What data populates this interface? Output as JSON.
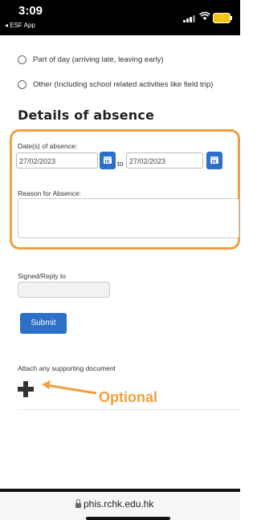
{
  "status_bar": {
    "time": "3:09",
    "back_app": "◂ ESF App"
  },
  "form": {
    "options": [
      {
        "label": "Part of day (arriving late, leaving early)"
      },
      {
        "label": "Other (Including school related activities like field trip)"
      }
    ],
    "section_title": "Details of absence",
    "date_label": "Date(s) of absence:",
    "date_from": "27/02/2023",
    "to_label": "to",
    "date_to": "27/02/2023",
    "reason_label": "Reason for Absence:",
    "reason_value": "",
    "signed_label": "Signed/Reply to",
    "signed_value": "",
    "submit_label": "Submit",
    "attach_label": "Attach any supporting document"
  },
  "annotation": {
    "text": "Optional",
    "color": "#f0a040"
  },
  "browser": {
    "url": "phis.rchk.edu.hk"
  },
  "colors": {
    "primary_button": "#2d70c8",
    "highlight": "#f0a040"
  }
}
